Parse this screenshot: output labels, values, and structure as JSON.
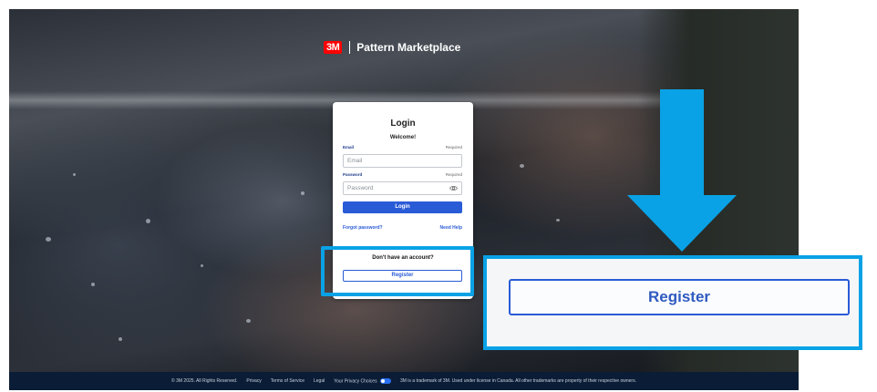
{
  "header": {
    "logo_text": "3M",
    "brand_name": "Pattern Marketplace"
  },
  "login": {
    "title": "Login",
    "welcome": "Welcome!",
    "email_label": "Email",
    "email_required": "Required",
    "email_placeholder": "Email",
    "password_label": "Password",
    "password_required": "Required",
    "password_placeholder": "Password",
    "login_button": "Login",
    "forgot_password": "Forgot password?",
    "need_help": "Need Help",
    "no_account": "Don't have an account?",
    "register_button": "Register"
  },
  "zoom": {
    "register_button": "Register"
  },
  "footer": {
    "copyright": "© 3M 2025. All Rights Reserved.",
    "privacy": "Privacy",
    "terms": "Terms of Service",
    "legal": "Legal",
    "privacy_choices": "Your Privacy Choices",
    "trademark": "3M is a trademark of 3M. Used under license in Canada. All other trademarks are property of their respective owners."
  },
  "colors": {
    "highlight": "#0aa2e6",
    "primary": "#2a5bd7",
    "logo_red": "#ff0000",
    "footer_bg": "#0b1d36"
  },
  "icons": {
    "password_toggle": "eye-icon",
    "callout_arrow": "arrow-down-icon"
  }
}
